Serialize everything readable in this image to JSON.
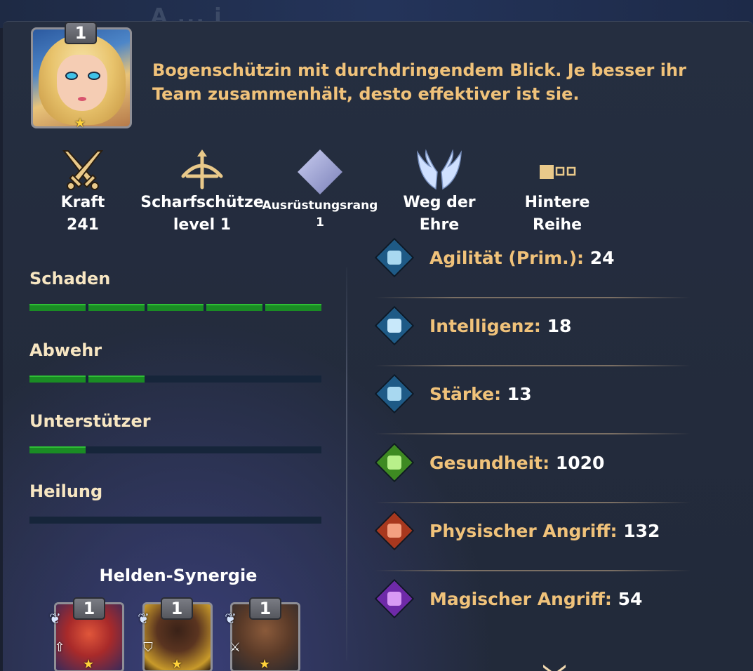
{
  "background": {
    "faded_title": "A ... i"
  },
  "hero": {
    "level": "1",
    "stars": 1,
    "description": "Bogenschützin mit durchdringendem Blick. Je besser ihr Team zusammenhält, desto effektiver ist sie."
  },
  "attributes": {
    "kraft": {
      "label": "Kraft",
      "value": "241"
    },
    "sharpshooter": {
      "label": "Scharfschütze",
      "value": "level 1"
    },
    "equipment": {
      "label": "Ausrüstungsrang",
      "value": "1"
    },
    "way": {
      "label": "Weg der Ehre"
    },
    "row": {
      "label": "Hintere Reihe"
    }
  },
  "roles": [
    {
      "name": "Schaden",
      "segments_filled": 5,
      "segments_total": 5
    },
    {
      "name": "Abwehr",
      "segments_filled": 2,
      "segments_total": 5
    },
    {
      "name": "Unterstützer",
      "segments_filled": 1,
      "segments_total": 5
    },
    {
      "name": "Heilung",
      "segments_filled": 0,
      "segments_total": 5
    }
  ],
  "stats": [
    {
      "name": "Agilität (Prim.):",
      "value": "24",
      "icon": "agility-icon",
      "color": "#7fb8d8"
    },
    {
      "name": "Intelligenz:",
      "value": "18",
      "icon": "intelligence-icon",
      "color": "#7fb8d8"
    },
    {
      "name": "Stärke:",
      "value": "13",
      "icon": "strength-icon",
      "color": "#7fb8d8"
    },
    {
      "name": "Gesundheit:",
      "value": "1020",
      "icon": "health-icon",
      "color": "#6fcf4a"
    },
    {
      "name": "Physischer Angriff:",
      "value": "132",
      "icon": "physical-attack-icon",
      "color": "#d8502f"
    },
    {
      "name": "Magischer Angriff:",
      "value": "54",
      "icon": "magic-attack-icon",
      "color": "#9a3fd0"
    }
  ],
  "synergy": {
    "title": "Helden-Synergie",
    "heroes": [
      {
        "level": "1",
        "stars": 1,
        "role_icon": "arrow-up-icon"
      },
      {
        "level": "1",
        "stars": 1,
        "role_icon": "shield-icon"
      },
      {
        "level": "1",
        "stars": 1,
        "role_icon": "axe-icon"
      }
    ]
  },
  "colors": {
    "accent_text": "#f0c27a",
    "bar_fill": "#1a8c24",
    "bar_empty": "#16253a"
  }
}
